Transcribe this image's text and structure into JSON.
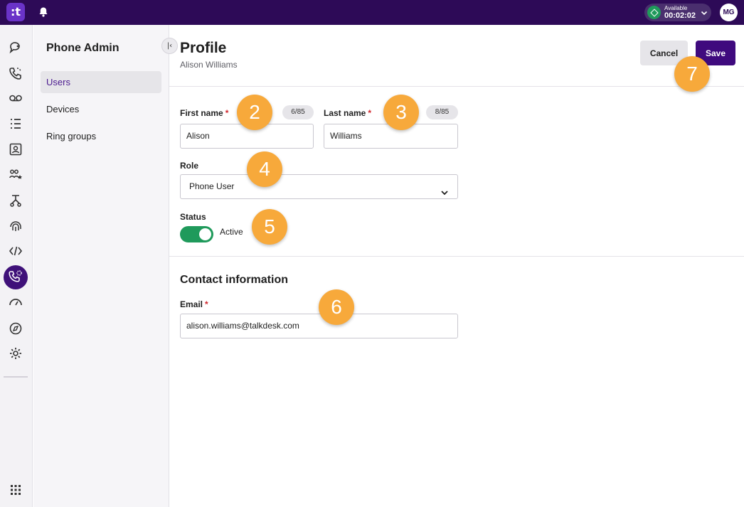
{
  "topbar": {
    "logo_glyph": ":t",
    "status_label": "Available",
    "status_time": "00:02:02",
    "avatar_initials": "MG",
    "status_color": "#1f9a5b",
    "brand_color": "#2d0a57"
  },
  "rail": {
    "icons": [
      "chat-bubble-icon",
      "phone-call-icon",
      "voicemail-icon",
      "list-icon",
      "contact-card-icon",
      "team-star-icon",
      "routing-icon",
      "fingerprint-icon",
      "code-icon",
      "phone-admin-icon",
      "gauge-icon",
      "compass-icon",
      "settings-icon",
      "apps-grid-icon"
    ],
    "active_icon": "phone-admin-icon"
  },
  "sidebar": {
    "title": "Phone Admin",
    "items": [
      {
        "label": "Users",
        "active": true
      },
      {
        "label": "Devices",
        "active": false
      },
      {
        "label": "Ring groups",
        "active": false
      }
    ]
  },
  "header": {
    "title": "Profile",
    "subtitle": "Alison Williams",
    "cancel_label": "Cancel",
    "save_label": "Save"
  },
  "form": {
    "first_name": {
      "label": "First name",
      "required_mark": "*",
      "counter": "6/85",
      "value": "Alison"
    },
    "last_name": {
      "label": "Last name",
      "required_mark": "*",
      "counter": "8/85",
      "value": "Williams"
    },
    "role": {
      "label": "Role",
      "value": "Phone User"
    },
    "status": {
      "label": "Status",
      "value": "Active",
      "on": true
    }
  },
  "contact": {
    "section_title": "Contact information",
    "email": {
      "label": "Email",
      "required_mark": "*",
      "value": "alison.williams@talkdesk.com"
    }
  },
  "callouts": [
    "2",
    "3",
    "4",
    "5",
    "6",
    "7"
  ]
}
